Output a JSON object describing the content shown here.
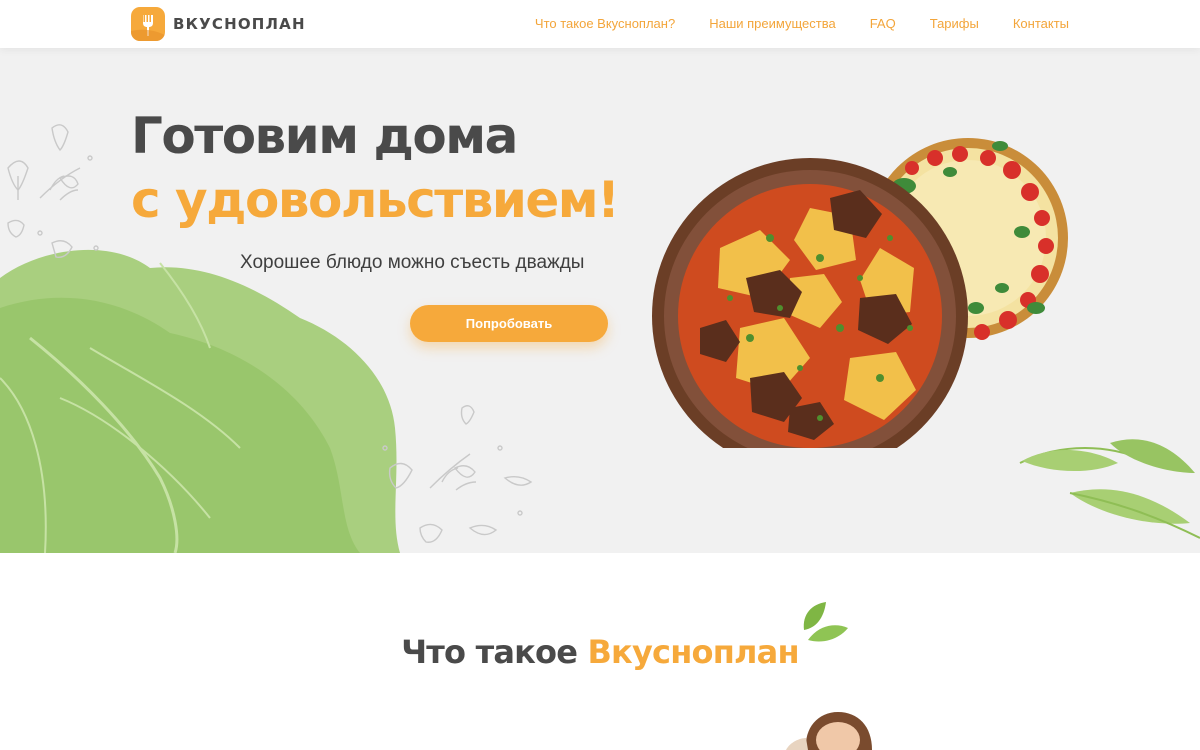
{
  "brand": {
    "name": "ВКУСНОПЛАН",
    "color": "#f6a93b",
    "logo_icon": "fork-icon"
  },
  "nav": {
    "items": [
      {
        "label": "Что такое Вкусноплан?"
      },
      {
        "label": "Наши преимущества"
      },
      {
        "label": "FAQ"
      },
      {
        "label": "Тарифы"
      },
      {
        "label": "Контакты"
      }
    ]
  },
  "hero": {
    "title_line1": "Готовим дома",
    "title_line2": "с удовольствием!",
    "subtitle": "Хорошее блюдо можно съесть дважды",
    "cta_label": "Попробовать"
  },
  "section": {
    "title_part1": "Что такое ",
    "title_part2": "Вкусноплан"
  },
  "colors": {
    "accent": "#f6a93b",
    "text_dark": "#4a4a4a",
    "hero_bg": "#f1f1f1",
    "leaf_green": "#8fbe55"
  }
}
